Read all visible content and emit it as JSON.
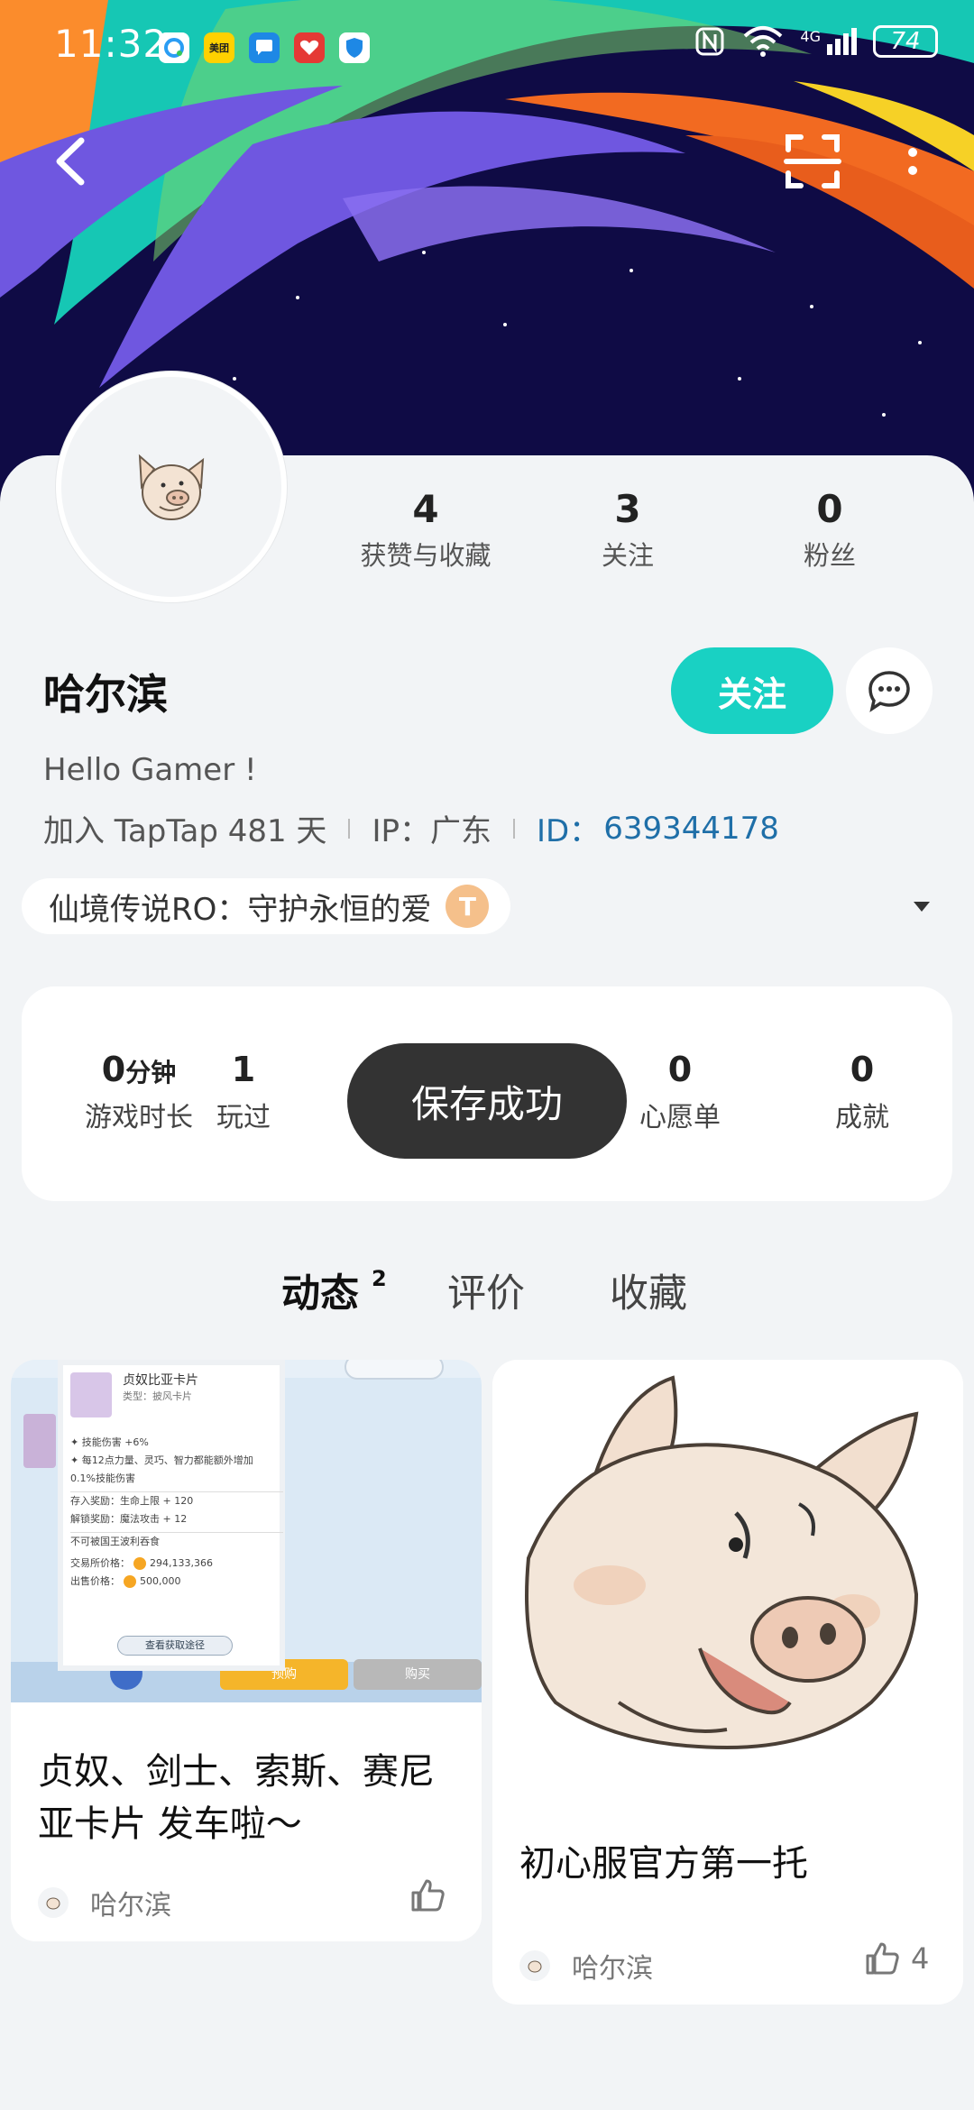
{
  "status_bar": {
    "time": "11:32",
    "battery": "74",
    "network": "4G",
    "app_icons": [
      "qq-browser-icon",
      "meituan-icon",
      "messages-icon",
      "health-icon",
      "security-icon"
    ],
    "meituan_text": "美团"
  },
  "profile": {
    "username": "哈尔滨",
    "bio": "Hello Gamer !",
    "joined": "加入 TapTap 481 天",
    "ip_label": "IP：",
    "ip_value": "广东",
    "id_label": "ID：",
    "id_value": "639344178",
    "follow_label": "关注",
    "stats": [
      {
        "value": "4",
        "label": "获赞与收藏"
      },
      {
        "value": "3",
        "label": "关注"
      },
      {
        "value": "0",
        "label": "粉丝"
      }
    ]
  },
  "game_tag": {
    "name": "仙境传说RO：守护永恒的爱",
    "badge": "T"
  },
  "game_stats": [
    {
      "value": "0",
      "unit": "分钟",
      "label": "游戏时长"
    },
    {
      "value": "1",
      "label": "玩过"
    },
    {
      "value": "0",
      "label": "心愿单"
    },
    {
      "value": "0",
      "label": "成就"
    }
  ],
  "toast": "保存成功",
  "tabs": [
    {
      "label": "动态",
      "badge": "2"
    },
    {
      "label": "评价"
    },
    {
      "label": "收藏"
    }
  ],
  "cards": [
    {
      "title_line1": "贞奴、剑士、索斯、赛尼",
      "title_line2": "亚卡片 发车啦～",
      "author": "哈尔滨",
      "likes": "",
      "screenshot": {
        "card_name": "贞奴比亚卡片",
        "type_line": "类型：披风卡片",
        "effect1": "✦ 技能伤害 +6%",
        "effect2": "✦ 每12点力量、灵巧、智力都能额外增加",
        "effect2b": "0.1%技能伤害",
        "reward1": "存入奖励：生命上限 + 120",
        "reward2": "解锁奖励：魔法攻击 + 12",
        "note": "不可被国王波利吞食",
        "trade_price_label": "交易所价格：",
        "trade_price": "294,133,366",
        "sell_price_label": "出售价格：",
        "sell_price": "500,000",
        "source_btn": "查看获取途径",
        "btn_left": "预购",
        "btn_right": "购买"
      }
    },
    {
      "title_line1": "初心服官方第一托",
      "author": "哈尔滨",
      "likes": "4"
    }
  ]
}
